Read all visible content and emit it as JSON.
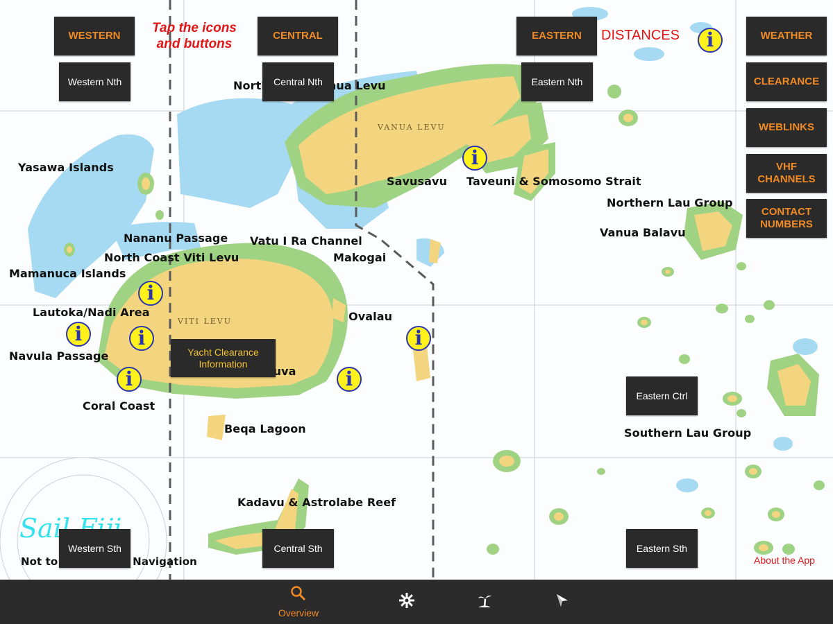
{
  "instruction": "Tap the icons\nand buttons",
  "distances_label": "DISTANCES",
  "region_buttons": {
    "western": "WESTERN",
    "central": "CENTRAL",
    "eastern": "EASTERN",
    "western_nth": "Western Nth",
    "central_nth": "Central Nth",
    "eastern_nth": "Eastern Nth",
    "eastern_ctrl": "Eastern Ctrl",
    "western_sth": "Western Sth",
    "central_sth": "Central Sth",
    "eastern_sth": "Eastern Sth",
    "yacht_clearance": "Yacht Clearance\nInformation"
  },
  "side_menu": {
    "weather": "WEATHER",
    "clearance": "CLEARANCE",
    "weblinks": "WEBLINKS",
    "vhf": "VHF\nCHANNELS",
    "contact": "CONTACT\nNUMBERS"
  },
  "map_labels": {
    "north_vanua_levu": "North Coast Vanua Levu",
    "vanua_levu_chart": "VANUA LEVU",
    "viti_levu_chart": "VITI LEVU",
    "yasawa": "Yasawa Islands",
    "savusavu": "Savusavu",
    "taveuni": "Taveuni & Somosomo Strait",
    "northern_lau": "Northern Lau Group",
    "vanua_balavu": "Vanua Balavu",
    "nananu": "Nananu Passage",
    "vatu_i_ra": "Vatu I Ra Channel",
    "north_coast_viti": "North Coast Viti Levu",
    "makogai": "Makogai",
    "mamanuca": "Mamanuca Islands",
    "lautoka": "Lautoka/Nadi Area",
    "ovalau": "Ovalau",
    "navula": "Navula Passage",
    "suva": "Suva",
    "coral_coast": "Coral Coast",
    "beqa": "Beqa Lagoon",
    "southern_lau": "Southern Lau Group",
    "kadavu": "Kadavu & Astrolabe Reef",
    "not_for_nav": "Not to be used for Navigation"
  },
  "logo_text": "Sail Fiji",
  "about_link": "About the App",
  "info_icon_glyph": "i",
  "bottom_nav": {
    "overview_label": "Overview",
    "tabs": [
      "search-map-icon",
      "settings-gear-icon",
      "island-palm-icon",
      "compass-pin-icon"
    ]
  },
  "colors": {
    "button_bg": "#2a2a2a",
    "button_text": "#f08a24",
    "land": "#f3d57f",
    "reef": "#9fd283",
    "shallow_water": "#a6daf2",
    "info_yellow": "#fff21c",
    "info_blue": "#2a33b0",
    "accent_red": "#e01616",
    "nav_bar": "#2b2b2b"
  }
}
